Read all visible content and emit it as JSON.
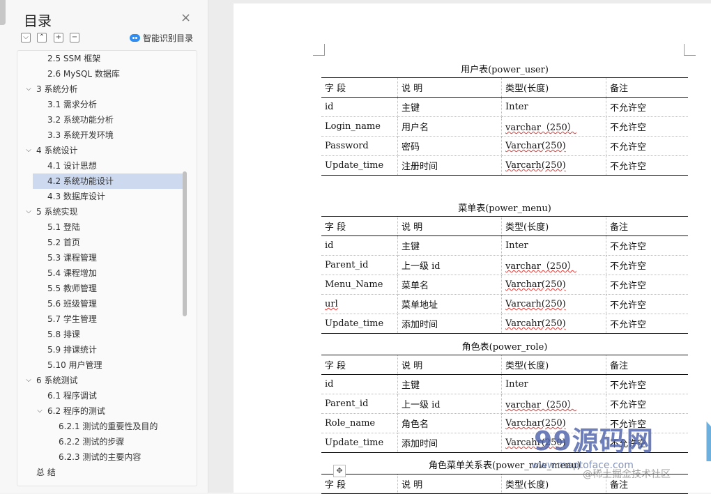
{
  "nav": {
    "title": "目录",
    "close": "×",
    "toolbar": [
      "⌵",
      "⌃",
      "+",
      "−"
    ],
    "smart_toc": "智能识别目录",
    "items": [
      {
        "label": "2.5 SSM 框架",
        "level": 2
      },
      {
        "label": "2.6 MySQL 数据库",
        "level": 2
      },
      {
        "label": "3 系统分析",
        "level": 1,
        "arrow": "⌵"
      },
      {
        "label": "3.1 需求分析",
        "level": 2
      },
      {
        "label": "3.2 系统功能分析",
        "level": 2
      },
      {
        "label": "3.3 系统开发环境",
        "level": 2
      },
      {
        "label": "4 系统设计",
        "level": 1,
        "arrow": "⌵"
      },
      {
        "label": "4.1 设计思想",
        "level": 2
      },
      {
        "label": "4.2 系统功能设计",
        "level": 2,
        "selected": true
      },
      {
        "label": "4.3 数据库设计",
        "level": 2
      },
      {
        "label": "5 系统实现",
        "level": 1,
        "arrow": "⌵"
      },
      {
        "label": "5.1 登陆",
        "level": 2
      },
      {
        "label": "5.2 首页",
        "level": 2
      },
      {
        "label": "5.3 课程管理",
        "level": 2
      },
      {
        "label": "5.4 课程增加",
        "level": 2
      },
      {
        "label": "5.5 教师管理",
        "level": 2
      },
      {
        "label": "5.6 班级管理",
        "level": 2
      },
      {
        "label": "5.7 学生管理",
        "level": 2
      },
      {
        "label": "5.8 排课",
        "level": 2
      },
      {
        "label": "5.9 排课统计",
        "level": 2
      },
      {
        "label": "5.10 用户管理",
        "level": 2
      },
      {
        "label": "6 系统测试",
        "level": 1,
        "arrow": "⌵"
      },
      {
        "label": "6.1  程序调试",
        "level": 2
      },
      {
        "label": "6.2  程序的测试",
        "level": 2,
        "arrow": "⌵"
      },
      {
        "label": "6.2.1  测试的重要性及目的",
        "level": 3
      },
      {
        "label": "6.2.2  测试的步骤",
        "level": 3
      },
      {
        "label": "6.2.3  测试的主要内容",
        "level": 3
      },
      {
        "label": "总   结",
        "level": 1
      }
    ]
  },
  "doc": {
    "header": [
      "字    段",
      "说    明",
      "类型(长度)",
      "备注"
    ],
    "tables": [
      {
        "caption": "用户表(power_user)",
        "rows": [
          [
            "id",
            "主键",
            "Inter",
            "不允许空"
          ],
          [
            "Login_name",
            "用户名",
            "varchar（250）",
            "不允许空"
          ],
          [
            "Password",
            "密码",
            "Varchar(250)",
            "不允许空"
          ],
          [
            "Update_time",
            "注册时间",
            "Varcarh(250)",
            "不允许空"
          ]
        ]
      },
      {
        "caption": "菜单表(power_menu)",
        "rows": [
          [
            "id",
            "主键",
            "Inter",
            "不允许空"
          ],
          [
            "Parent_id",
            "上一级 id",
            "varchar（250）",
            "不允许空"
          ],
          [
            "Menu_Name",
            "菜单名",
            "Varchar(250)",
            "不允许空"
          ],
          [
            "url",
            "菜单地址",
            "Varcarh(250)",
            "不允许空"
          ],
          [
            "Update_time",
            "添加时间",
            "Varcahr(250)",
            "不允许空"
          ]
        ]
      },
      {
        "caption": "角色表(power_role)",
        "rows": [
          [
            "id",
            "主键",
            "Inter",
            "不允许空"
          ],
          [
            "Parent_id",
            "上一级 id",
            "varchar（250）",
            "不允许空"
          ],
          [
            "Role_name",
            "角色名",
            "Varchar(250)",
            "不允许空"
          ],
          [
            "Update_time",
            "添加时间",
            "Varcahr(250)",
            "不允许空"
          ]
        ]
      },
      {
        "caption": "角色菜单关系表(power_role_menu)",
        "rows": []
      }
    ],
    "move_handle": "✥"
  },
  "watermark": {
    "brand": "99源码网",
    "url": "www.maptoface.com",
    "community": "@稀土掘金技术社区"
  }
}
